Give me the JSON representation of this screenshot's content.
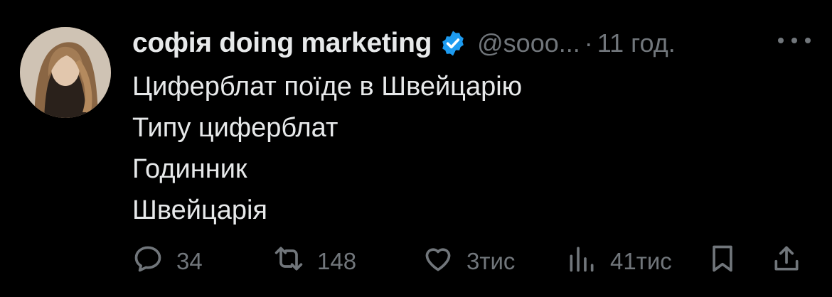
{
  "tweet": {
    "author_name": "софія doing marketing",
    "handle": "@sooo...",
    "separator": "·",
    "time": "11 год.",
    "lines": [
      "Циферблат поїде в Швейцарію",
      "Типу циферблат",
      "Годинник",
      "Швейцарія"
    ]
  },
  "actions": {
    "replies": "34",
    "retweets": "148",
    "likes": "3тис",
    "views": "41тис"
  },
  "icons": {
    "verified": "verified-badge-icon",
    "more": "more-options-icon",
    "reply": "reply-icon",
    "retweet": "retweet-icon",
    "like": "heart-icon",
    "views": "views-icon",
    "bookmark": "bookmark-icon",
    "share": "share-icon"
  },
  "colors": {
    "background": "#000000",
    "text": "#e7e9ea",
    "muted": "#71767b",
    "verified": "#1d9bf0"
  }
}
